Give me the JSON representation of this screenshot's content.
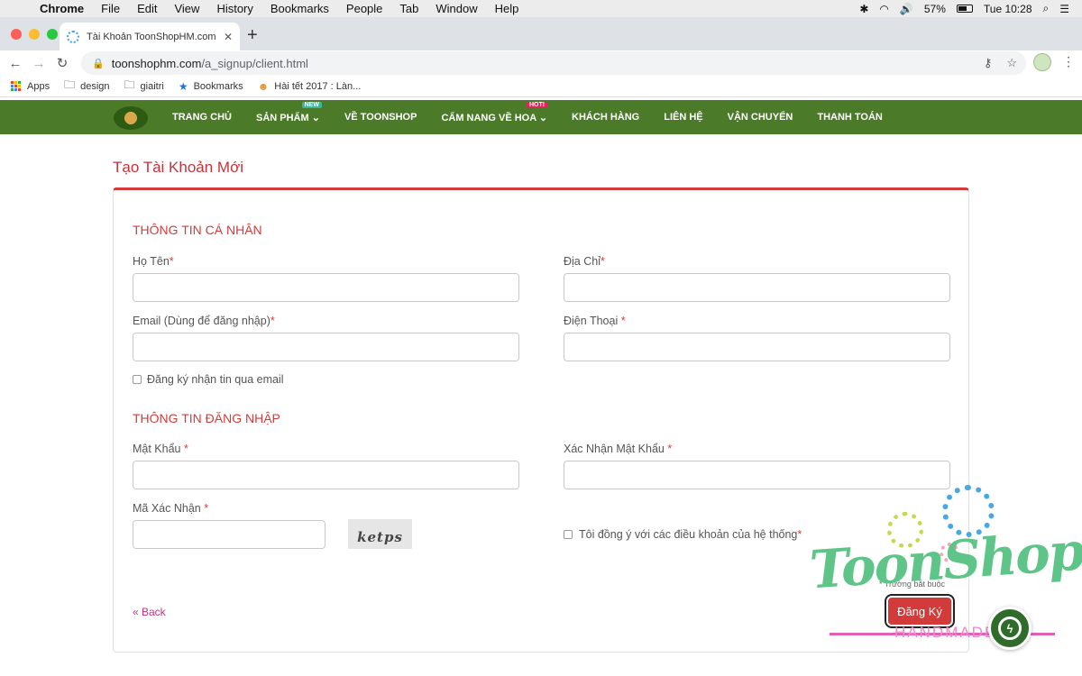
{
  "mac_menubar": {
    "app": "Chrome",
    "menus": [
      "File",
      "Edit",
      "View",
      "History",
      "Bookmarks",
      "People",
      "Tab",
      "Window",
      "Help"
    ],
    "battery": "57%",
    "clock": "Tue 10:28"
  },
  "browser": {
    "tab_title": "Tài Khoản ToonShopHM.com",
    "url_domain": "toonshophm.com",
    "url_path": "/a_signup/client.html",
    "bookmarks": [
      "Apps",
      "design",
      "giaitri",
      "Bookmarks",
      "Hài tết 2017 : Làn..."
    ]
  },
  "site_nav": {
    "items": [
      "TRANG CHỦ",
      "SẢN PHẨM",
      "VỀ TOONSHOP",
      "CẨM NANG VỀ HOA",
      "KHÁCH HÀNG",
      "LIÊN HỆ",
      "VẬN CHUYỂN",
      "THANH TOÁN"
    ],
    "badge_new": "NEW",
    "badge_hot": "HOT!"
  },
  "page": {
    "title": "Tạo Tài Khoản Mới"
  },
  "form": {
    "personal_title": "THÔNG TIN CÁ NHÂN",
    "full_name_label": "Họ Tên",
    "address_label": "Địa Chỉ",
    "email_label": "Email (Dùng để đăng nhập)",
    "phone_label": "Điện Thoại ",
    "newsletter_label": "Đăng ký nhận tin qua email",
    "login_title": "THÔNG TIN ĐĂNG NHẬP",
    "password_label": "Mật Khẩu ",
    "confirm_password_label": "Xác Nhận Mật Khẩu ",
    "captcha_label": "Mã Xác Nhận ",
    "captcha_text": "ketps",
    "terms_label": "Tôi đồng ý với các điều khoản của hệ thống",
    "required_mark": "*",
    "back_label": "« Back",
    "required_note": "* Trường bắt buộc",
    "submit_label": "Đăng Ký"
  },
  "watermark": {
    "brand": "ToonShop",
    "subtitle": "HANDMADE"
  },
  "colors": {
    "nav_green": "#4b7a28",
    "accent_red": "#d33b3b",
    "watermark_green": "#5fc487",
    "watermark_pink": "#f087c8"
  }
}
